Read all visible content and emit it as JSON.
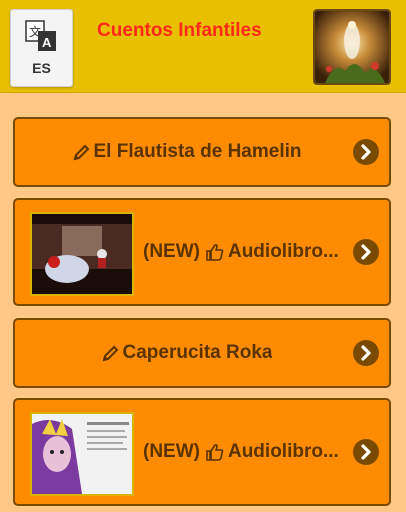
{
  "header": {
    "language_code": "ES",
    "title": "Cuentos Infantiles"
  },
  "icons": {
    "translate": "translate-icon",
    "pencil": "pencil-icon",
    "thumbs_up": "thumbs-up-icon",
    "chevron": "chevron-right-circle-icon"
  },
  "colors": {
    "header_bg": "#e8c000",
    "page_bg": "#ffc887",
    "card_bg": "#ff8c00",
    "card_border": "#7a4a00",
    "title_red": "#ff2a1a"
  },
  "items": [
    {
      "prefix": "",
      "title": "El Flautista de Hamelin"
    },
    {
      "prefix": "(NEW)",
      "title": "Audiolibro..."
    },
    {
      "prefix": "",
      "title": "Caperucita Roka"
    },
    {
      "prefix": "(NEW)",
      "title": "Audiolibro..."
    }
  ]
}
